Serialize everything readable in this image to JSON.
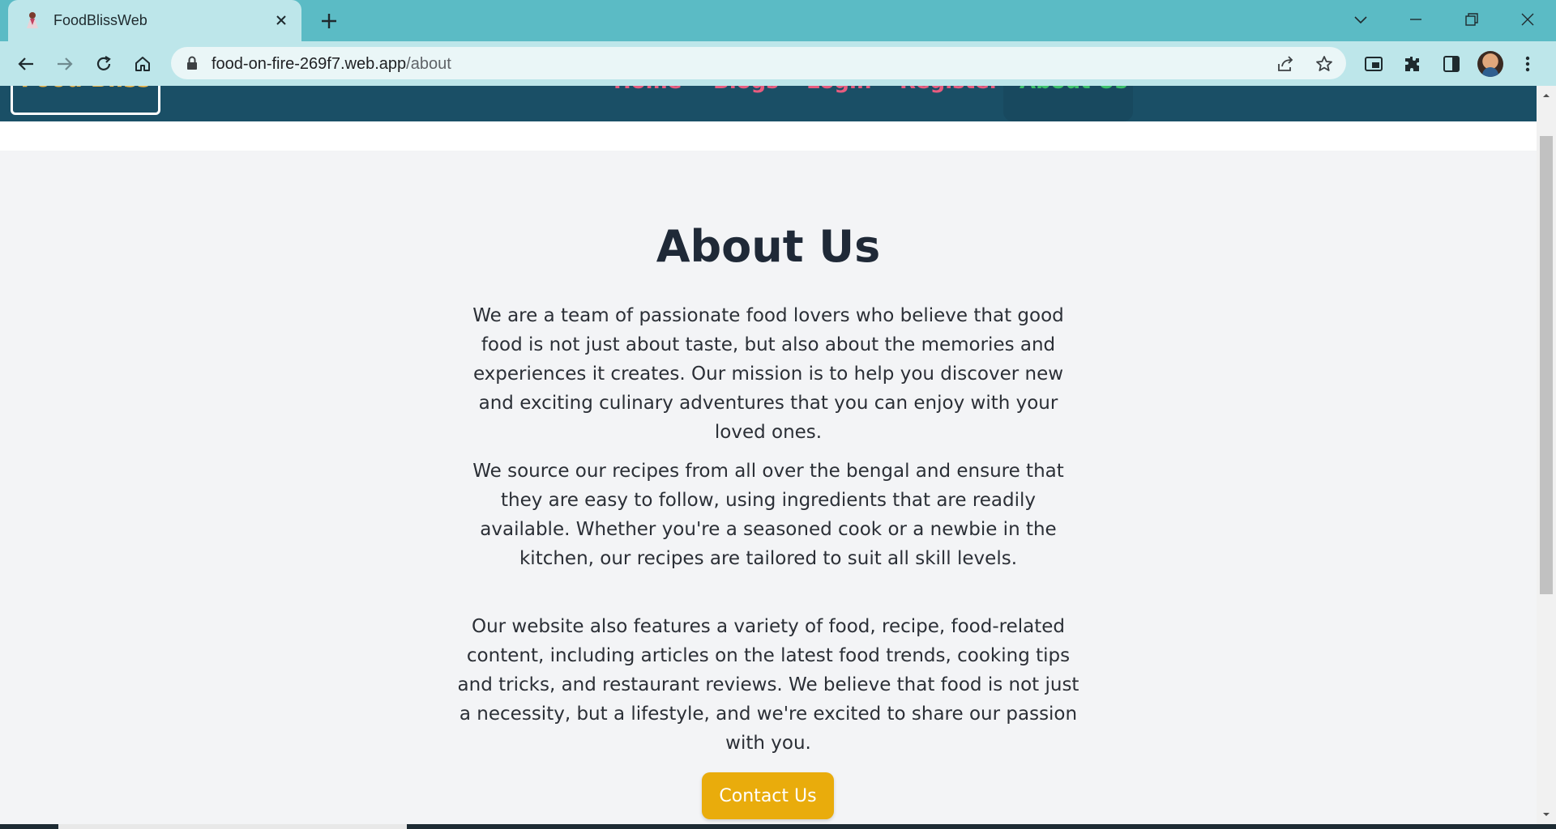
{
  "browser": {
    "tab_title": "FoodBlissWeb",
    "url_host": "food-on-fire-269f7.web.app",
    "url_path": "/about",
    "icons": [
      "favicon-icon",
      "close-icon",
      "plus-icon",
      "chevron-down-icon",
      "minimize-icon",
      "restore-icon",
      "window-close-icon",
      "back-icon",
      "forward-icon",
      "reload-icon",
      "home-icon",
      "lock-icon",
      "share-icon",
      "star-icon",
      "picture-in-picture-icon",
      "extensions-icon",
      "side-panel-icon",
      "profile-avatar",
      "menu-icon"
    ]
  },
  "site": {
    "logo": "Food Bliss",
    "nav": {
      "home": "Home",
      "blogs": "Blogs",
      "login": "Login",
      "register": "Register",
      "about": "About Us"
    },
    "colors": {
      "header": "#1a4f66",
      "nav": "#e85c7f",
      "nav_active": "#3cc06a",
      "logo": "#f2b544",
      "button": "#e9ac0c"
    }
  },
  "about": {
    "title": "About Us",
    "p1": "We are a team of passionate food lovers who believe that good food is not just about taste, but also about the memories and experiences it creates. Our mission is to help you discover new and exciting culinary adventures that you can enjoy with your loved ones.",
    "p2": "We source our recipes from all over the bengal and ensure that they are easy to follow, using ingredients that are readily available. Whether you're a seasoned cook or a newbie in the kitchen, our recipes are tailored to suit all skill levels.",
    "p3": "Our website also features a variety of food, recipe, food-related content, including articles on the latest food trends, cooking tips and tricks, and restaurant reviews. We believe that food is not just a necessity, but a lifestyle, and we're excited to share our passion with you.",
    "contact_button": "Contact Us"
  }
}
